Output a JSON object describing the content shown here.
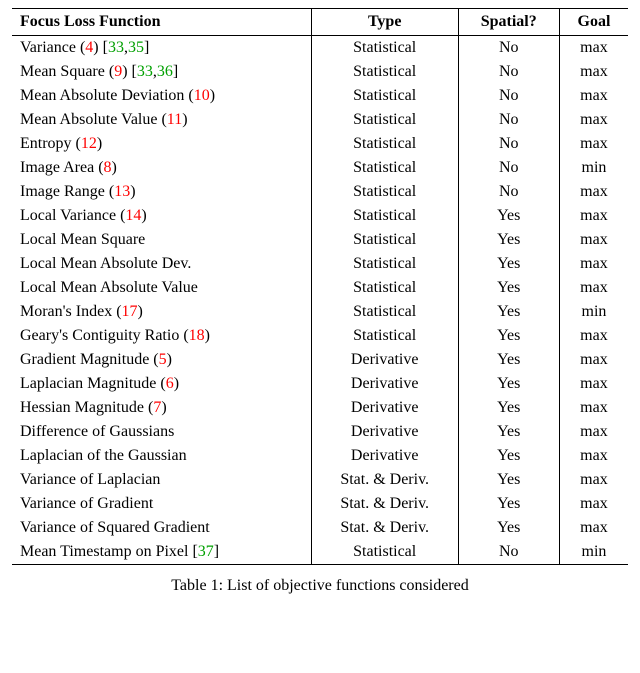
{
  "headers": [
    "Focus Loss Function",
    "Type",
    "Spatial?",
    "Goal"
  ],
  "rows": [
    {
      "name": "Variance",
      "eq": "4",
      "refs": [
        "33",
        "35"
      ],
      "type": "Statistical",
      "spatial": "No",
      "goal": "max"
    },
    {
      "name": "Mean Square",
      "eq": "9",
      "refs": [
        "33",
        "36"
      ],
      "type": "Statistical",
      "spatial": "No",
      "goal": "max"
    },
    {
      "name": "Mean Absolute Deviation",
      "eq": "10",
      "refs": [],
      "type": "Statistical",
      "spatial": "No",
      "goal": "max"
    },
    {
      "name": "Mean Absolute Value",
      "eq": "11",
      "refs": [],
      "type": "Statistical",
      "spatial": "No",
      "goal": "max"
    },
    {
      "name": "Entropy",
      "eq": "12",
      "refs": [],
      "type": "Statistical",
      "spatial": "No",
      "goal": "max"
    },
    {
      "name": "Image Area",
      "eq": "8",
      "refs": [],
      "type": "Statistical",
      "spatial": "No",
      "goal": "min"
    },
    {
      "name": "Image Range",
      "eq": "13",
      "refs": [],
      "type": "Statistical",
      "spatial": "No",
      "goal": "max"
    },
    {
      "name": "Local Variance",
      "eq": "14",
      "refs": [],
      "type": "Statistical",
      "spatial": "Yes",
      "goal": "max"
    },
    {
      "name": "Local Mean Square",
      "eq": "",
      "refs": [],
      "type": "Statistical",
      "spatial": "Yes",
      "goal": "max"
    },
    {
      "name": "Local Mean Absolute Dev.",
      "eq": "",
      "refs": [],
      "type": "Statistical",
      "spatial": "Yes",
      "goal": "max"
    },
    {
      "name": "Local Mean Absolute Value",
      "eq": "",
      "refs": [],
      "type": "Statistical",
      "spatial": "Yes",
      "goal": "max"
    },
    {
      "name": "Moran's Index",
      "eq": "17",
      "refs": [],
      "type": "Statistical",
      "spatial": "Yes",
      "goal": "min"
    },
    {
      "name": "Geary's Contiguity Ratio",
      "eq": "18",
      "refs": [],
      "type": "Statistical",
      "spatial": "Yes",
      "goal": "max"
    },
    {
      "name": "Gradient Magnitude",
      "eq": "5",
      "refs": [],
      "type": "Derivative",
      "spatial": "Yes",
      "goal": "max"
    },
    {
      "name": "Laplacian Magnitude",
      "eq": "6",
      "refs": [],
      "type": "Derivative",
      "spatial": "Yes",
      "goal": "max"
    },
    {
      "name": "Hessian Magnitude",
      "eq": "7",
      "refs": [],
      "type": "Derivative",
      "spatial": "Yes",
      "goal": "max"
    },
    {
      "name": "Difference of Gaussians",
      "eq": "",
      "refs": [],
      "type": "Derivative",
      "spatial": "Yes",
      "goal": "max"
    },
    {
      "name": "Laplacian of the Gaussian",
      "eq": "",
      "refs": [],
      "type": "Derivative",
      "spatial": "Yes",
      "goal": "max"
    },
    {
      "name": "Variance of Laplacian",
      "eq": "",
      "refs": [],
      "type": "Stat. & Deriv.",
      "spatial": "Yes",
      "goal": "max"
    },
    {
      "name": "Variance of Gradient",
      "eq": "",
      "refs": [],
      "type": "Stat. & Deriv.",
      "spatial": "Yes",
      "goal": "max"
    },
    {
      "name": "Variance of Squared Gradient",
      "eq": "",
      "refs": [],
      "type": "Stat. & Deriv.",
      "spatial": "Yes",
      "goal": "max"
    },
    {
      "name": "Mean Timestamp on Pixel",
      "eq": "",
      "refs": [
        "37"
      ],
      "type": "Statistical",
      "spatial": "No",
      "goal": "min"
    }
  ],
  "caption_prefix": "Table 1: ",
  "caption_text": "List of objective functions considered"
}
